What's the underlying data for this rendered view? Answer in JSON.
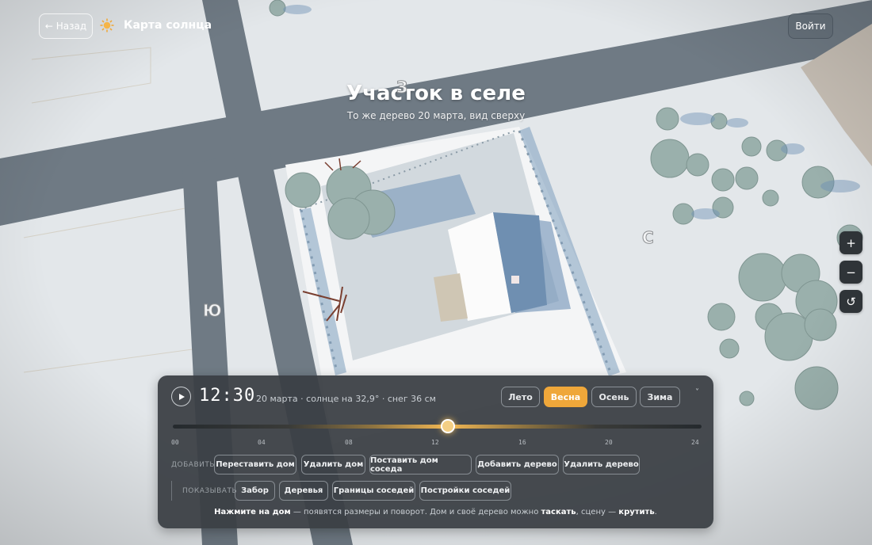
{
  "header": {
    "back_label": "← Назад",
    "app_title": "Карта солнца",
    "login_label": "Войти"
  },
  "scene": {
    "title": "Участок в селе",
    "subtitle": "То же дерево 20 марта, вид сверху",
    "compass": {
      "west": "З",
      "north": "С",
      "south": "Ю"
    }
  },
  "map_controls": {
    "zoom_in": "+",
    "zoom_out": "−",
    "reset": "↺"
  },
  "panel": {
    "time": "12:30",
    "status": "20 марта · солнце на 32,9° · снег 36 см",
    "seasons": [
      "Лето",
      "Весна",
      "Осень",
      "Зима"
    ],
    "active_season": "Весна",
    "collapse_label": "˅",
    "timeline": {
      "ticks": [
        "00",
        "04",
        "08",
        "12",
        "16",
        "20",
        "24"
      ],
      "value_hours": 12.5,
      "max_hours": 24
    },
    "add_label": "ДОБАВИТЬ",
    "add_buttons": [
      "Переставить дом",
      "Удалить дом",
      "Поставить дом соседа",
      "Добавить дерево",
      "Удалить дерево"
    ],
    "show_label": "ПОКАЗЫВАТЬ",
    "show_buttons": [
      "Забор",
      "Деревья",
      "Границы соседей",
      "Постройки соседей"
    ],
    "hint": {
      "part1": "Нажмите на дом",
      "part2": " — появятся размеры и поворот. Дом и своё дерево можно ",
      "part3": "таскать",
      "part4": ", сцену — ",
      "part5": "крутить",
      "part6": "."
    }
  },
  "colors": {
    "accent": "#efa73a",
    "panel": "#3a3f44",
    "road": "#6f7a84",
    "snow": "#e9ecee",
    "tree": "#97aaa6"
  }
}
